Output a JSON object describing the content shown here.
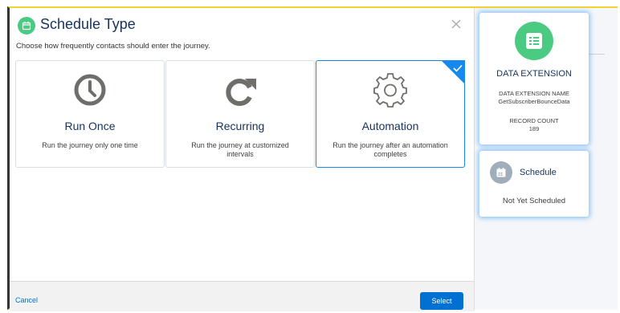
{
  "modal": {
    "title": "Schedule Type",
    "subtitle": "Choose how frequently contacts should enter the journey.",
    "options": [
      {
        "name": "Run Once",
        "desc": "Run the journey only one time",
        "icon": "clock-icon",
        "selected": false
      },
      {
        "name": "Recurring",
        "desc": "Run the journey at customized intervals",
        "icon": "refresh-icon",
        "selected": false
      },
      {
        "name": "Automation",
        "desc": "Run the journey after an automation completes",
        "icon": "gear-icon",
        "selected": true
      }
    ],
    "footer": {
      "cancel_label": "Cancel",
      "select_label": "Select"
    }
  },
  "data_extension": {
    "title": "DATA EXTENSION",
    "name_label": "DATA EXTENSION NAME",
    "name_value": "GetSubscriberBounceData",
    "count_label": "RECORD COUNT",
    "count_value": "189",
    "icon": "table-icon"
  },
  "schedule": {
    "title": "Schedule",
    "status": "Not Yet Scheduled",
    "icon": "calendar-icon"
  },
  "colors": {
    "accent": "#1589ee",
    "brand_green": "#4bca81",
    "button_blue": "#0070d2",
    "frame_yellow": "#f2d330"
  }
}
